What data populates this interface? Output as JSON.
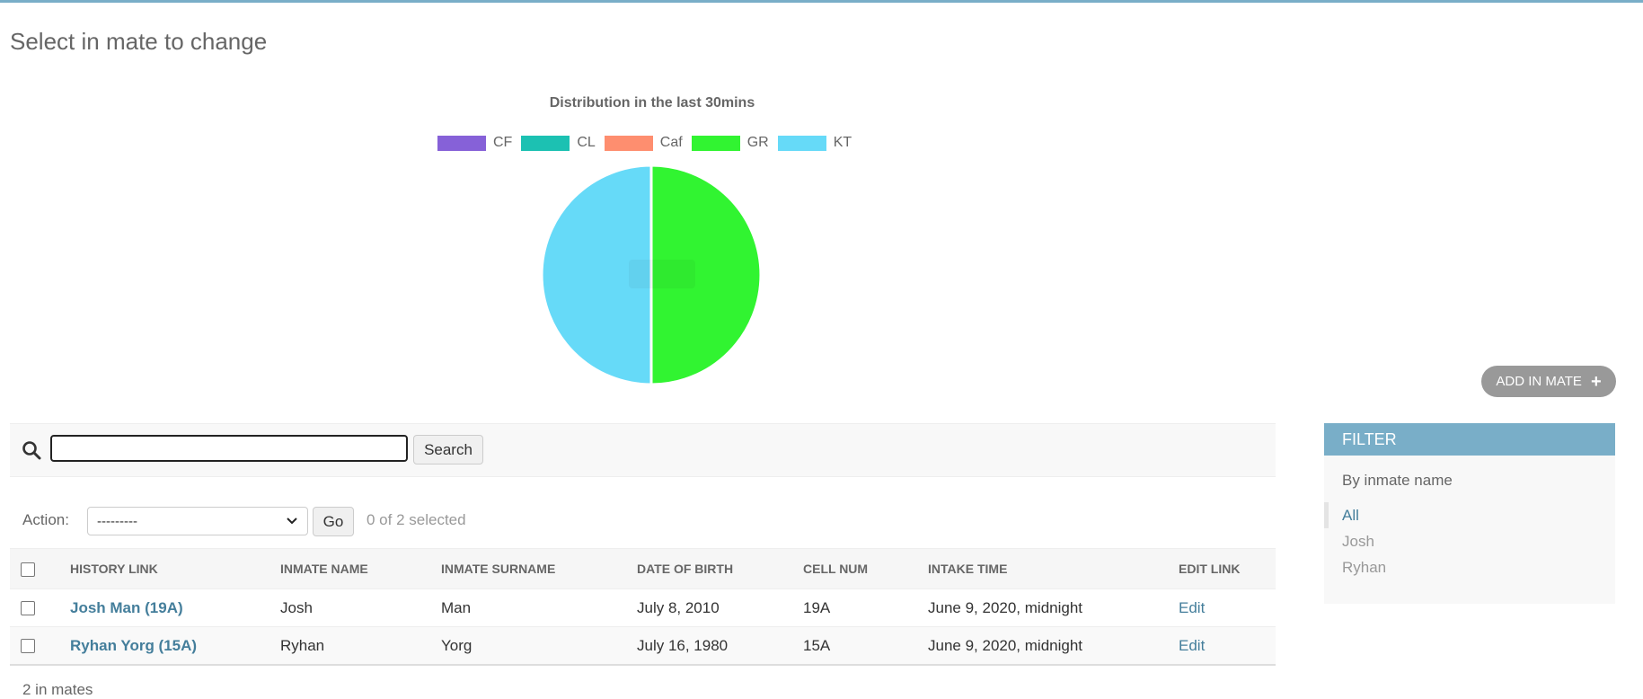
{
  "page_title": "Select in mate to change",
  "chart_data": {
    "type": "pie",
    "title": "Distribution in the last 30mins",
    "legend_position": "top",
    "categories": [
      "CF",
      "CL",
      "Caf",
      "GR",
      "KT"
    ],
    "values": [
      0,
      0,
      0,
      1,
      1
    ],
    "colors": [
      "#8661d8",
      "#1cc1b2",
      "#fe8e6f",
      "#31f431",
      "#66daf8"
    ]
  },
  "add_button": {
    "label": "ADD IN MATE"
  },
  "search": {
    "button_label": "Search",
    "value": ""
  },
  "actions": {
    "label": "Action:",
    "selected_option": "---------",
    "go_label": "Go",
    "selected_count": "0 of 2 selected"
  },
  "table": {
    "columns": [
      "HISTORY LINK",
      "INMATE NAME",
      "INMATE SURNAME",
      "DATE OF BIRTH",
      "CELL NUM",
      "INTAKE TIME",
      "EDIT LINK"
    ],
    "rows": [
      {
        "history_link": "Josh Man (19A)",
        "name": "Josh",
        "surname": "Man",
        "dob": "July 8, 2010",
        "cell": "19A",
        "intake": "June 9, 2020, midnight",
        "edit": "Edit"
      },
      {
        "history_link": "Ryhan Yorg (15A)",
        "name": "Ryhan",
        "surname": "Yorg",
        "dob": "July 16, 1980",
        "cell": "15A",
        "intake": "June 9, 2020, midnight",
        "edit": "Edit"
      }
    ]
  },
  "paginator": "2 in mates",
  "filter": {
    "title": "FILTER",
    "subtitle": "By inmate name",
    "items": [
      "All",
      "Josh",
      "Ryhan"
    ],
    "active_item": "All"
  },
  "colors": {
    "accent": "#79aec8",
    "link": "#447e9b"
  }
}
